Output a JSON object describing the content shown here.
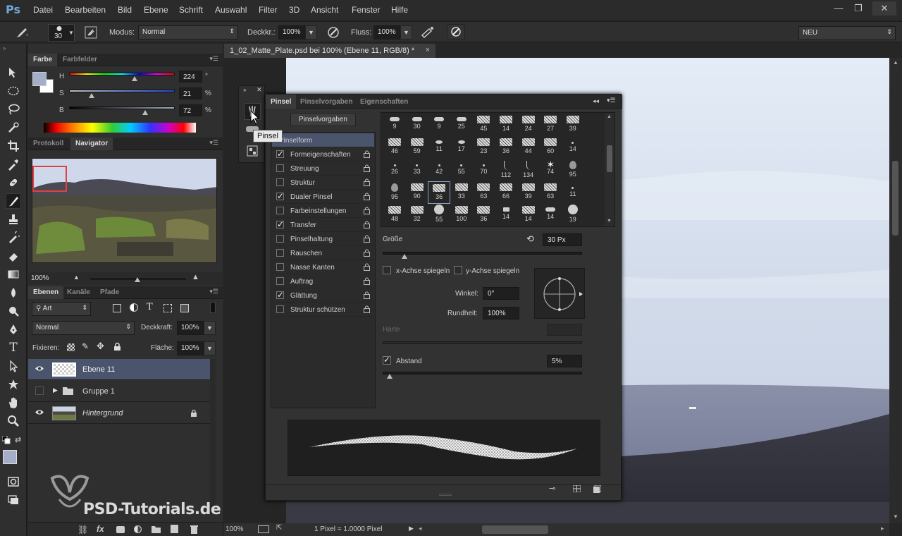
{
  "app": {
    "logo": "Ps"
  },
  "menubar": {
    "items": [
      "Datei",
      "Bearbeiten",
      "Bild",
      "Ebene",
      "Schrift",
      "Auswahl",
      "Filter",
      "3D",
      "Ansicht",
      "Fenster",
      "Hilfe"
    ],
    "window_buttons": [
      "—",
      "❐",
      "✕"
    ]
  },
  "options": {
    "brush_size": "30",
    "modus_label": "Modus:",
    "modus_value": "Normal",
    "deckkraft_label": "Deckkr.:",
    "deckkraft_value": "100%",
    "fluss_label": "Fluss:",
    "fluss_value": "100%",
    "workspace": "NEU"
  },
  "color_panel": {
    "tabs": [
      "Farbe",
      "Farbfelder"
    ],
    "rows": [
      {
        "label": "H",
        "value": "224",
        "unit": "°",
        "level": 0.62
      },
      {
        "label": "S",
        "value": "21",
        "unit": "%",
        "level": 0.21
      },
      {
        "label": "B",
        "value": "72",
        "unit": "%",
        "level": 0.72
      }
    ],
    "foreground": "#a4aec8",
    "background": "#ffffff"
  },
  "navigator_panel": {
    "tabs": [
      "Protokoll",
      "Navigator"
    ],
    "zoom": "100%"
  },
  "layers_panel": {
    "tabs": [
      "Ebenen",
      "Kanäle",
      "Pfade"
    ],
    "filter": "Art",
    "blend_mode": "Normal",
    "deckkraft_label": "Deckkraft:",
    "deckkraft_value": "100%",
    "fixieren_label": "Fixieren:",
    "flaeche_label": "Fläche:",
    "flaeche_value": "100%",
    "layers": [
      {
        "name": "Ebene 11",
        "visible": true,
        "selected": true
      },
      {
        "name": "Gruppe 1",
        "visible": false,
        "selected": false
      },
      {
        "name": "Hintergrund",
        "visible": true,
        "selected": false
      }
    ]
  },
  "document": {
    "tab_title": "1_02_Matte_Plate.psd bei 100% (Ebene 11, RGB/8) *",
    "close": "×",
    "status_zoom": "100%",
    "status_info": "1 Pixel = 1.0000 Pixel"
  },
  "brush_panel": {
    "tabs": [
      "Pinsel",
      "Pinselvorgaben",
      "Eigenschaften"
    ],
    "preset_button": "Pinselvorgaben",
    "tooltip": "Pinsel",
    "list": [
      {
        "label": "Pinselform",
        "checked": null,
        "lock": false
      },
      {
        "label": "Formeigenschaften",
        "checked": true,
        "lock": true
      },
      {
        "label": "Streuung",
        "checked": false,
        "lock": true
      },
      {
        "label": "Struktur",
        "checked": false,
        "lock": true
      },
      {
        "label": "Dualer Pinsel",
        "checked": true,
        "lock": true
      },
      {
        "label": "Farbeinstellungen",
        "checked": false,
        "lock": true
      },
      {
        "label": "Transfer",
        "checked": true,
        "lock": true
      },
      {
        "label": "Pinselhaltung",
        "checked": false,
        "lock": true
      },
      {
        "label": "Rauschen",
        "checked": false,
        "lock": true
      },
      {
        "label": "Nasse Kanten",
        "checked": false,
        "lock": true
      },
      {
        "label": "Auftrag",
        "checked": false,
        "lock": true
      },
      {
        "label": "Glättung",
        "checked": true,
        "lock": true
      },
      {
        "label": "Struktur schützen",
        "checked": false,
        "lock": true
      }
    ],
    "tips": [
      "9",
      "30",
      "9",
      "25",
      "45",
      "14",
      "24",
      "27",
      "39",
      "46",
      "59",
      "11",
      "17",
      "23",
      "36",
      "44",
      "60",
      "14",
      "26",
      "33",
      "42",
      "55",
      "70",
      "112",
      "134",
      "74",
      "95",
      "95",
      "90",
      "36",
      "33",
      "63",
      "66",
      "39",
      "63",
      "11",
      "48",
      "32",
      "55",
      "100",
      "36",
      "14",
      "14",
      "14",
      "19"
    ],
    "size_label": "Größe",
    "size_value": "30 Px",
    "size_level": 0.06,
    "flip_x": "x-Achse spiegeln",
    "flip_y": "y-Achse spiegeln",
    "angle_label": "Winkel:",
    "angle_value": "0°",
    "roundness_label": "Rundheit:",
    "roundness_value": "100%",
    "hardness_label": "Härte",
    "spacing_label": "Abstand",
    "spacing_value": "5%",
    "spacing_level": 0.02
  },
  "watermark": "PSD-Tutorials.de",
  "colors": {
    "accent": "#3f4a63",
    "panel": "#323232",
    "selection": "#e14040"
  }
}
